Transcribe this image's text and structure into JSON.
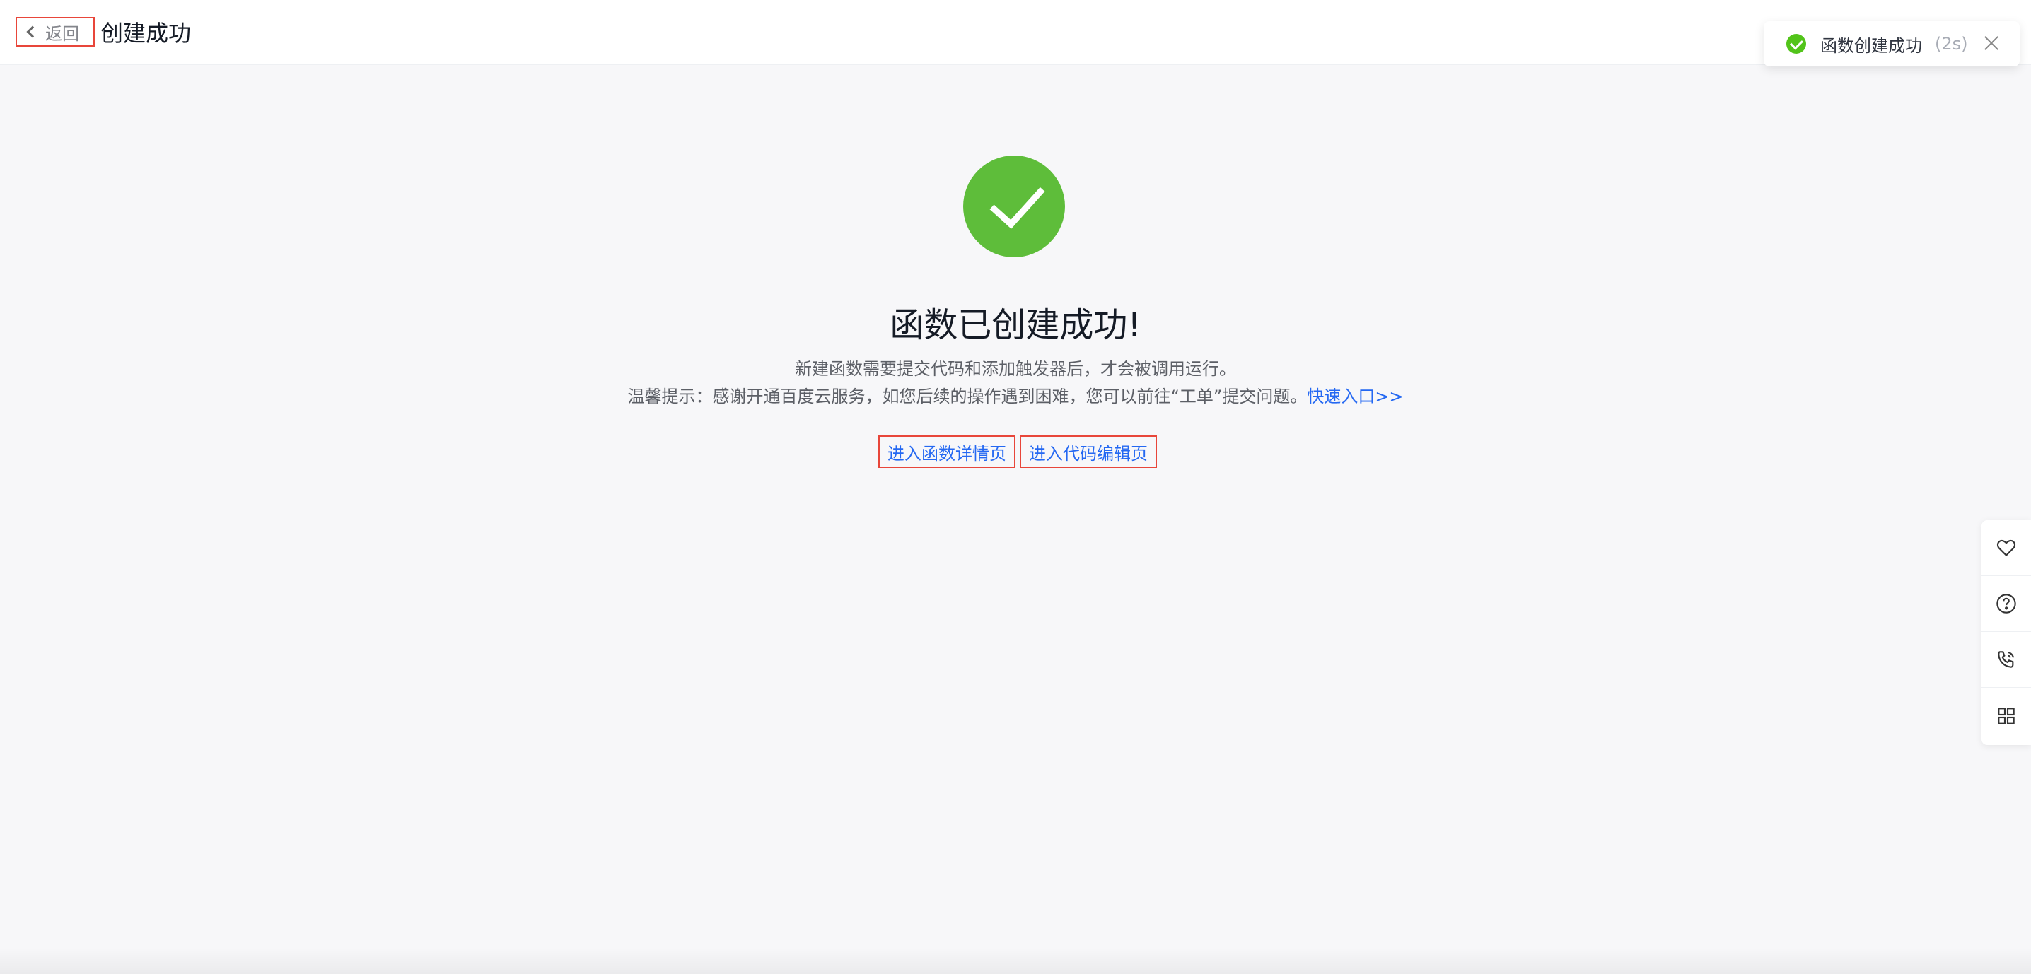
{
  "header": {
    "back_label": "返回",
    "title": "创建成功"
  },
  "toast": {
    "message": "函数创建成功",
    "countdown": "(2s)"
  },
  "main": {
    "headline": "函数已创建成功!",
    "description": "新建函数需要提交代码和添加触发器后，才会被调用运行。",
    "tip_text": "温馨提示：感谢开通百度云服务，如您后续的操作遇到困难，您可以前往“工单”提交问题。",
    "tip_link": "快速入口>>",
    "actions": [
      {
        "label": "进入函数详情页"
      },
      {
        "label": "进入代码编辑页"
      }
    ]
  },
  "side_toolbar": {
    "items": [
      {
        "icon": "heart-icon"
      },
      {
        "icon": "help-icon"
      },
      {
        "icon": "phone-icon"
      },
      {
        "icon": "grid-icon"
      }
    ]
  },
  "colors": {
    "success": "#5ebd3a",
    "link": "#2468f2",
    "highlight_border": "#e8463a"
  }
}
